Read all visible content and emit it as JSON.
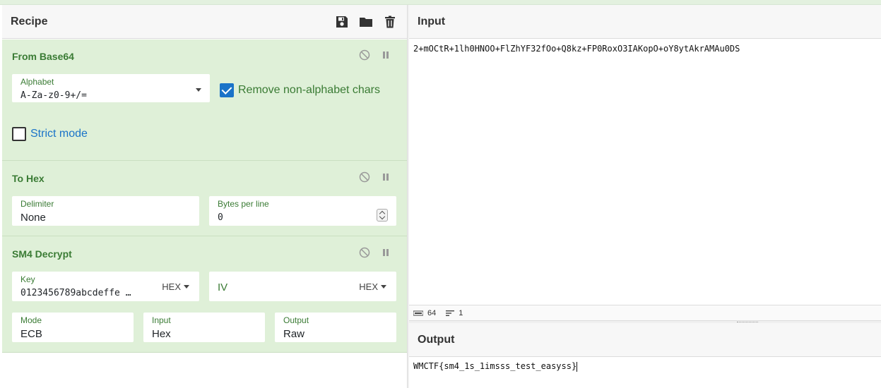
{
  "recipe": {
    "title": "Recipe",
    "tools": [
      "save-icon",
      "folder-icon",
      "trash-icon"
    ]
  },
  "operations": {
    "from_base64": {
      "title": "From Base64",
      "alphabet_label": "Alphabet",
      "alphabet_value": "A-Za-z0-9+/=",
      "remove_label": "Remove non-alphabet chars",
      "remove_checked": true,
      "strict_label": "Strict mode",
      "strict_checked": false
    },
    "to_hex": {
      "title": "To Hex",
      "delimiter_label": "Delimiter",
      "delimiter_value": "None",
      "bytes_label": "Bytes per line",
      "bytes_value": "0"
    },
    "sm4": {
      "title": "SM4 Decrypt",
      "key_label": "Key",
      "key_value": "0123456789abcdeffe …",
      "key_format": "HEX",
      "iv_label": "IV",
      "iv_format": "HEX",
      "mode_label": "Mode",
      "mode_value": "ECB",
      "input_label": "Input",
      "input_value": "Hex",
      "output_label": "Output",
      "output_value": "Raw"
    }
  },
  "input": {
    "title": "Input",
    "text": "2+mOCtR+1lh0HNOO+FlZhYF32fOo+Q8kz+FP0RoxO3IAKopO+oY8ytAkrAMAu0DS"
  },
  "status": {
    "length_icon": "abc-icon",
    "length": "64",
    "lines_icon": "lines-icon",
    "lines": "1"
  },
  "output": {
    "title": "Output",
    "text": "WMCTF{sm4_1s_1imsss_test_easyss}"
  },
  "colors": {
    "op_bg": "#dff0d8",
    "op_title": "#3a7b34",
    "checkbox": "#1a73c8"
  }
}
